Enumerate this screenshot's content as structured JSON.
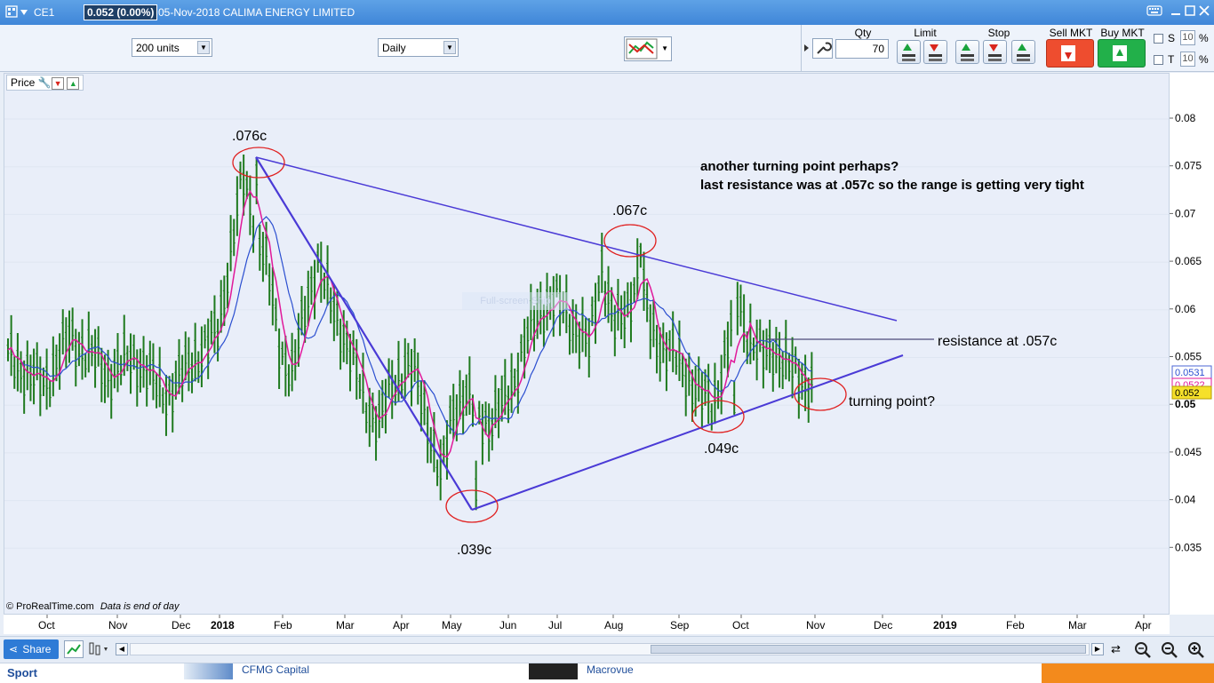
{
  "titlebar": {
    "symbol": "CE1",
    "price_status": "0.052 (0.00%)",
    "date_name": "05-Nov-2018 CALIMA ENERGY LIMITED",
    "window_icons": [
      "keyboard-icon",
      "minimize-icon",
      "maximize-icon",
      "close-icon"
    ]
  },
  "toolbar": {
    "units_select": "200 units",
    "period_select": "Daily",
    "qty_label": "Qty",
    "qty_value": "70",
    "limit_label": "Limit",
    "stop_label": "Stop",
    "sell_label": "Sell MKT",
    "buy_label": "Buy MKT",
    "s_label": "S",
    "t_label": "T",
    "s_value": "10",
    "t_value": "10",
    "percent": "%"
  },
  "chart_panel": {
    "label": "Price",
    "watermark": "Full-screen Snip",
    "copyright": "© ProRealTime.com",
    "data_note": "Data is end of day"
  },
  "annotations": {
    "high_label": ".076c",
    "low_label": ".039c",
    "peak_label": ".067c",
    "trough_label": ".049c",
    "note_line1": "another turning point perhaps?",
    "note_line2": "last resistance was at .057c so the range is getting very tight",
    "resistance_label": "resistance at .057c",
    "turning_label": "turning point?"
  },
  "price_axis": {
    "ticks": [
      "0.08",
      "0.075",
      "0.07",
      "0.065",
      "0.06",
      "0.055",
      "0.05",
      "0.045",
      "0.04",
      "0.035"
    ],
    "badge_ma_blue": "0.0531",
    "badge_ma_pink": "0.0522",
    "badge_last": "0.052"
  },
  "time_axis": {
    "labels": [
      "Oct",
      "Nov",
      "Dec",
      "2018",
      "Feb",
      "Mar",
      "Apr",
      "May",
      "Jun",
      "Jul",
      "Aug",
      "Sep",
      "Oct",
      "Nov",
      "Dec",
      "2019",
      "Feb",
      "Mar",
      "Apr"
    ]
  },
  "bottombar": {
    "share_label": "Share"
  },
  "statusbar": {
    "sport": "Sport",
    "item1": "CFMG Capital",
    "item2": "Macrovue"
  },
  "colors": {
    "bar_color": "#1f7a1f",
    "ma_pink": "#e0199a",
    "ma_blue": "#2b4fd0",
    "trendline": "#4a3ad6",
    "circle": "#e02020",
    "titlebar": "#4a90e2"
  },
  "chart_data": {
    "type": "ohlc_bar",
    "y_range": [
      0.03,
      0.084
    ],
    "y_ticks": [
      0.08,
      0.075,
      0.07,
      0.065,
      0.06,
      0.055,
      0.05,
      0.045,
      0.04,
      0.035
    ],
    "x_range": [
      "Oct 2017",
      "Apr 2019"
    ],
    "key_points": [
      {
        "label": ".076c",
        "date": "Jan 2018",
        "price": 0.076
      },
      {
        "label": ".039c",
        "date": "May 2018",
        "price": 0.039
      },
      {
        "label": ".067c",
        "date": "Aug 2018",
        "price": 0.067
      },
      {
        "label": ".049c",
        "date": "Sep 2018",
        "price": 0.049
      }
    ],
    "resistance": 0.057,
    "last_price": 0.052,
    "series": [
      {
        "name": "",
        "kind": "ohlc",
        "values_close_approx": [
          0.055,
          0.054,
          0.053,
          0.052,
          0.055,
          0.057,
          0.056,
          0.055,
          0.053,
          0.054,
          0.055,
          0.054,
          0.052,
          0.051,
          0.053,
          0.055,
          0.056,
          0.058,
          0.066,
          0.074,
          0.069,
          0.064,
          0.056,
          0.053,
          0.06,
          0.065,
          0.061,
          0.058,
          0.054,
          0.05,
          0.048,
          0.052,
          0.054,
          0.053,
          0.048,
          0.042,
          0.05,
          0.051,
          0.049,
          0.048,
          0.05,
          0.053,
          0.057,
          0.06,
          0.061,
          0.06,
          0.058,
          0.056,
          0.065,
          0.058,
          0.06,
          0.064,
          0.058,
          0.056,
          0.055,
          0.053,
          0.051,
          0.05,
          0.055,
          0.061,
          0.057,
          0.055,
          0.056,
          0.054,
          0.053,
          0.052
        ]
      }
    ]
  }
}
